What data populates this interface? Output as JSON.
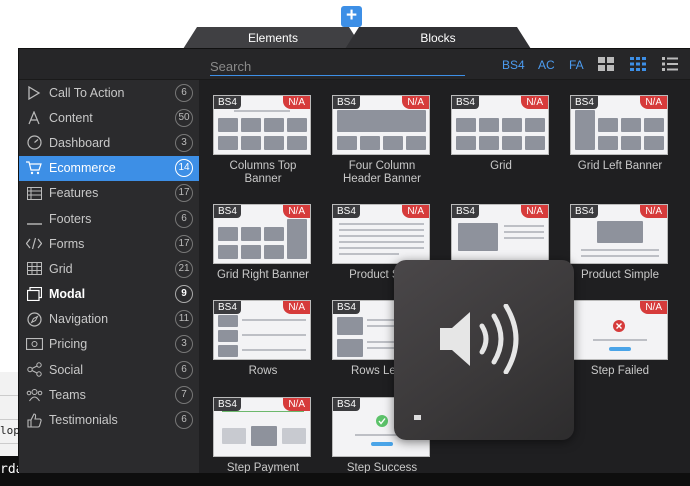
{
  "add_button": "+",
  "tabs": [
    {
      "label": "Elements"
    },
    {
      "label": "Blocks"
    }
  ],
  "search": {
    "placeholder": "Search"
  },
  "toolbar": {
    "bs4": "BS4",
    "ac": "AC",
    "fa": "FA"
  },
  "sidebar": [
    {
      "label": "Call To Action",
      "count": "6",
      "icon": "play-icon"
    },
    {
      "label": "Content",
      "count": "50",
      "icon": "text-icon"
    },
    {
      "label": "Dashboard",
      "count": "3",
      "icon": "gauge-icon"
    },
    {
      "label": "Ecommerce",
      "count": "14",
      "icon": "cart-icon",
      "active": true
    },
    {
      "label": "Features",
      "count": "17",
      "icon": "list-icon"
    },
    {
      "label": "Footers",
      "count": "6",
      "icon": "footer-icon"
    },
    {
      "label": "Forms",
      "count": "17",
      "icon": "code-icon"
    },
    {
      "label": "Grid",
      "count": "21",
      "icon": "grid-icon"
    },
    {
      "label": "Modal",
      "count": "9",
      "icon": "modal-icon",
      "bold": true
    },
    {
      "label": "Navigation",
      "count": "11",
      "icon": "compass-icon"
    },
    {
      "label": "Pricing",
      "count": "3",
      "icon": "price-icon"
    },
    {
      "label": "Social",
      "count": "6",
      "icon": "share-icon"
    },
    {
      "label": "Teams",
      "count": "7",
      "icon": "team-icon"
    },
    {
      "label": "Testimonials",
      "count": "6",
      "icon": "thumb-icon"
    }
  ],
  "cards": [
    {
      "title": "Columns Top Banner",
      "badge": "BS4",
      "na": "N/A"
    },
    {
      "title": "Four Column Header Banner",
      "badge": "BS4",
      "na": "N/A"
    },
    {
      "title": "Grid",
      "badge": "BS4",
      "na": "N/A"
    },
    {
      "title": "Grid Left Banner",
      "badge": "BS4",
      "na": "N/A"
    },
    {
      "title": "Grid Right Banner",
      "badge": "BS4",
      "na": "N/A"
    },
    {
      "title": "Product Side",
      "badge": "BS4",
      "na": "N/A"
    },
    {
      "title": "",
      "badge": "BS4",
      "na": "N/A"
    },
    {
      "title": "Product Simple",
      "badge": "BS4",
      "na": "N/A"
    },
    {
      "title": "Rows",
      "badge": "BS4",
      "na": "N/A"
    },
    {
      "title": "Rows Left B",
      "badge": "BS4",
      "na": ""
    },
    {
      "title": "",
      "badge": "",
      "na": ""
    },
    {
      "title": "Step Failed",
      "badge": "",
      "na": "N/A"
    },
    {
      "title": "Step Payment",
      "badge": "BS4",
      "na": "N/A"
    },
    {
      "title": "Step Success",
      "badge": "BS4",
      "na": ""
    }
  ],
  "background": {
    "rows": [
      "",
      "",
      "lopr",
      ""
    ],
    "terminal": "rda"
  },
  "colors": {
    "accent": "#3d8fe6",
    "na_badge": "#d63b3b",
    "panel": "#262628"
  }
}
